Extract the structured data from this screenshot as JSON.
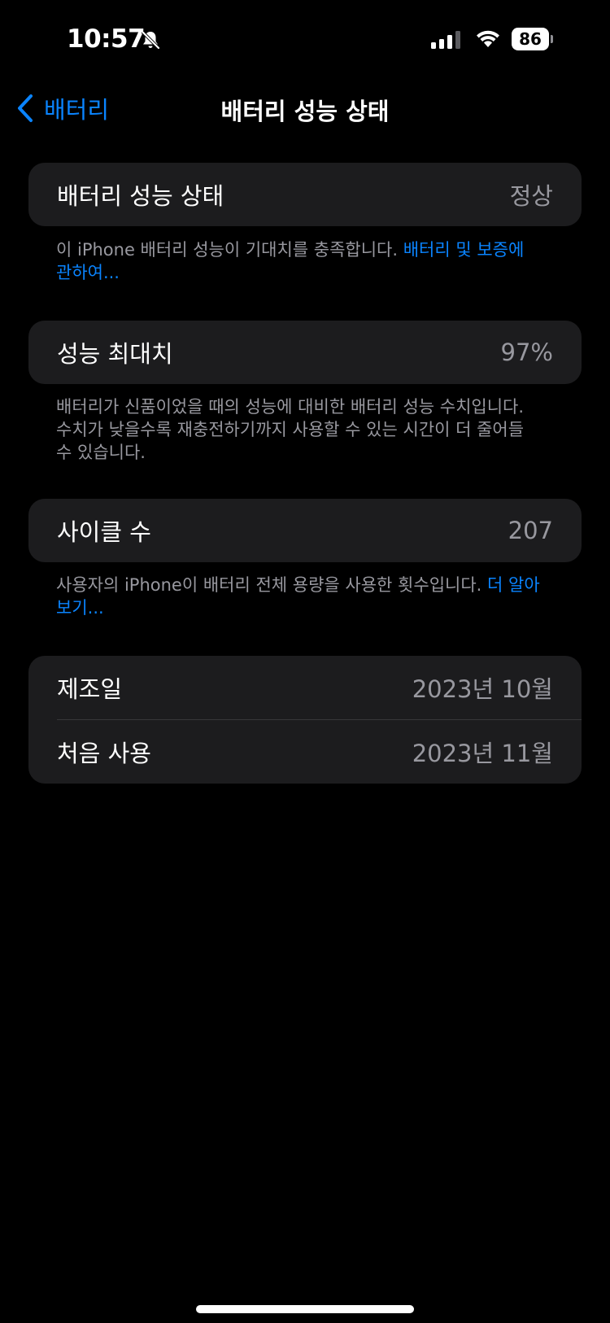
{
  "status_bar": {
    "time": "10:57",
    "battery_level": "86",
    "icons": [
      "bell-slash-icon",
      "cellular-signal-icon",
      "wifi-icon",
      "battery-icon"
    ]
  },
  "nav": {
    "back_label": "배터리",
    "title": "배터리 성능 상태"
  },
  "sections": {
    "health": {
      "label": "배터리 성능 상태",
      "value": "정상",
      "footnote": "이 iPhone 배터리 성능이 기대치를 충족합니다. ",
      "footnote_link": "배터리 및 보증에 관하여..."
    },
    "max_capacity": {
      "label": "성능 최대치",
      "value": "97%",
      "footnote": "배터리가 신품이었을 때의 성능에 대비한 배터리 성능 수치입니다. 수치가 낮을수록 재충전하기까지 사용할 수 있는 시간이 더 줄어들 수 있습니다."
    },
    "cycle_count": {
      "label": "사이클 수",
      "value": "207",
      "footnote": "사용자의 iPhone이 배터리 전체 용량을 사용한 횟수입니다. ",
      "footnote_link": "더 알아보기..."
    },
    "dates": {
      "manufacture_label": "제조일",
      "manufacture_value": "2023년 10월",
      "first_use_label": "처음 사용",
      "first_use_value": "2023년 11월"
    }
  },
  "colors": {
    "background": "#000000",
    "card": "#1c1c1e",
    "accent": "#0a84ff",
    "secondary_text": "#98989f"
  }
}
